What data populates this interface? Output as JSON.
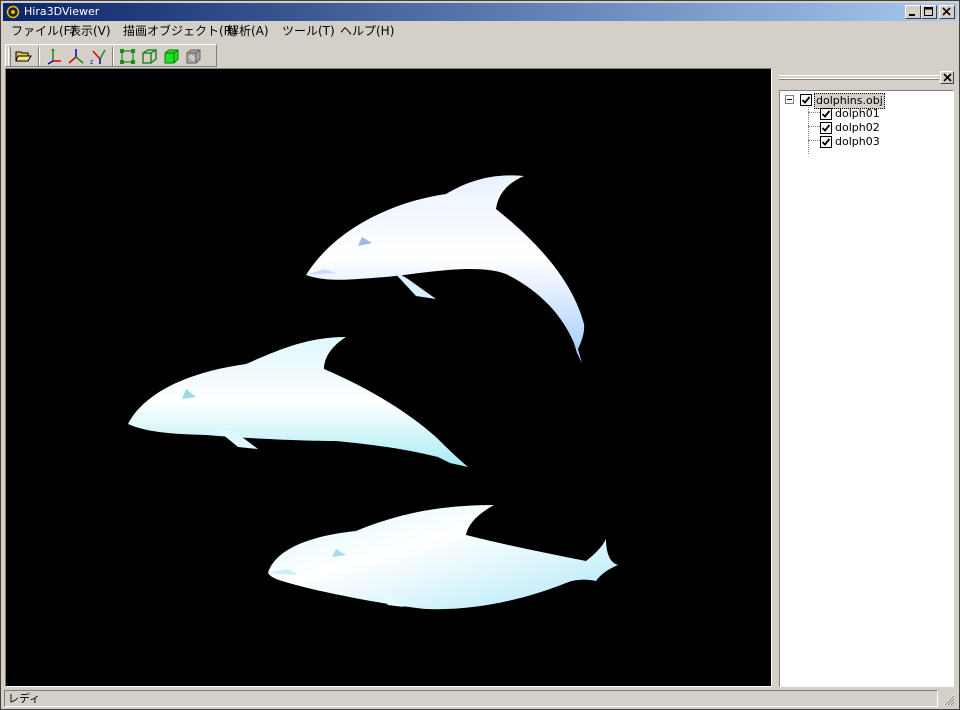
{
  "window": {
    "title": "Hira3DViewer",
    "controls": {
      "minimize": "minimize",
      "maximize": "maximize",
      "close": "close"
    }
  },
  "menubar": {
    "items": [
      {
        "label": "ファイル(F)"
      },
      {
        "label": "表示(V)"
      },
      {
        "label": "描画オブジェクト(R)"
      },
      {
        "label": "解析(A)"
      },
      {
        "label": "ツール(T)"
      },
      {
        "label": "ヘルプ(H)"
      }
    ]
  },
  "toolbar": {
    "buttons": [
      {
        "icon": "open-folder-icon"
      },
      {
        "icon": "axis-xy-icon"
      },
      {
        "icon": "axis-yz-icon"
      },
      {
        "icon": "axis-xz-icon"
      },
      {
        "icon": "vertex-mode-icon"
      },
      {
        "icon": "wireframe-mode-icon"
      },
      {
        "icon": "solid-mode-icon"
      },
      {
        "icon": "texture-mode-icon"
      }
    ]
  },
  "viewport": {
    "background": "#000000",
    "content": "three dolphin 3D models"
  },
  "object_tree": {
    "root": {
      "label": "dolphins.obj",
      "checked": true,
      "expanded": true,
      "selected": true
    },
    "children": [
      {
        "label": "dolph01",
        "checked": true
      },
      {
        "label": "dolph02",
        "checked": true
      },
      {
        "label": "dolph03",
        "checked": true
      }
    ]
  },
  "statusbar": {
    "text": "レディ"
  },
  "colors": {
    "titlebar_start": "#0a246a",
    "titlebar_end": "#a6caf0",
    "face": "#d4d0c8",
    "dolphin_light": "#ffffff",
    "dolphin_tint": "#bcd8ff"
  }
}
